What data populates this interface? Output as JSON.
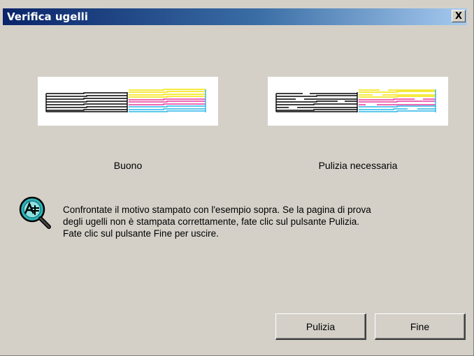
{
  "window": {
    "title": "Verifica ugelli",
    "close_label": "X"
  },
  "samples": {
    "good_label": "Buono",
    "bad_label": "Pulizia necessaria"
  },
  "message": {
    "lines": [
      "Confrontate il motivo stampato con l'esempio sopra. Se la pagina di prova",
      "degli ugelli non è stampata correttamente, fate clic sul pulsante Pulizia.",
      "Fate clic sul pulsante Fine per uscire."
    ]
  },
  "buttons": {
    "cleaning": "Pulizia",
    "finish": "Fine"
  },
  "icons": {
    "info": "nozzle-check-magnifier-icon",
    "close": "close-icon"
  },
  "colors": {
    "title_start": "#0a246a",
    "title_end": "#a6caf0",
    "dialog_bg": "#d4d0c8",
    "pattern_black": "#000000",
    "pattern_cyan": "#29b6e8",
    "pattern_magenta": "#e8389a",
    "pattern_yellow": "#f2e300"
  }
}
